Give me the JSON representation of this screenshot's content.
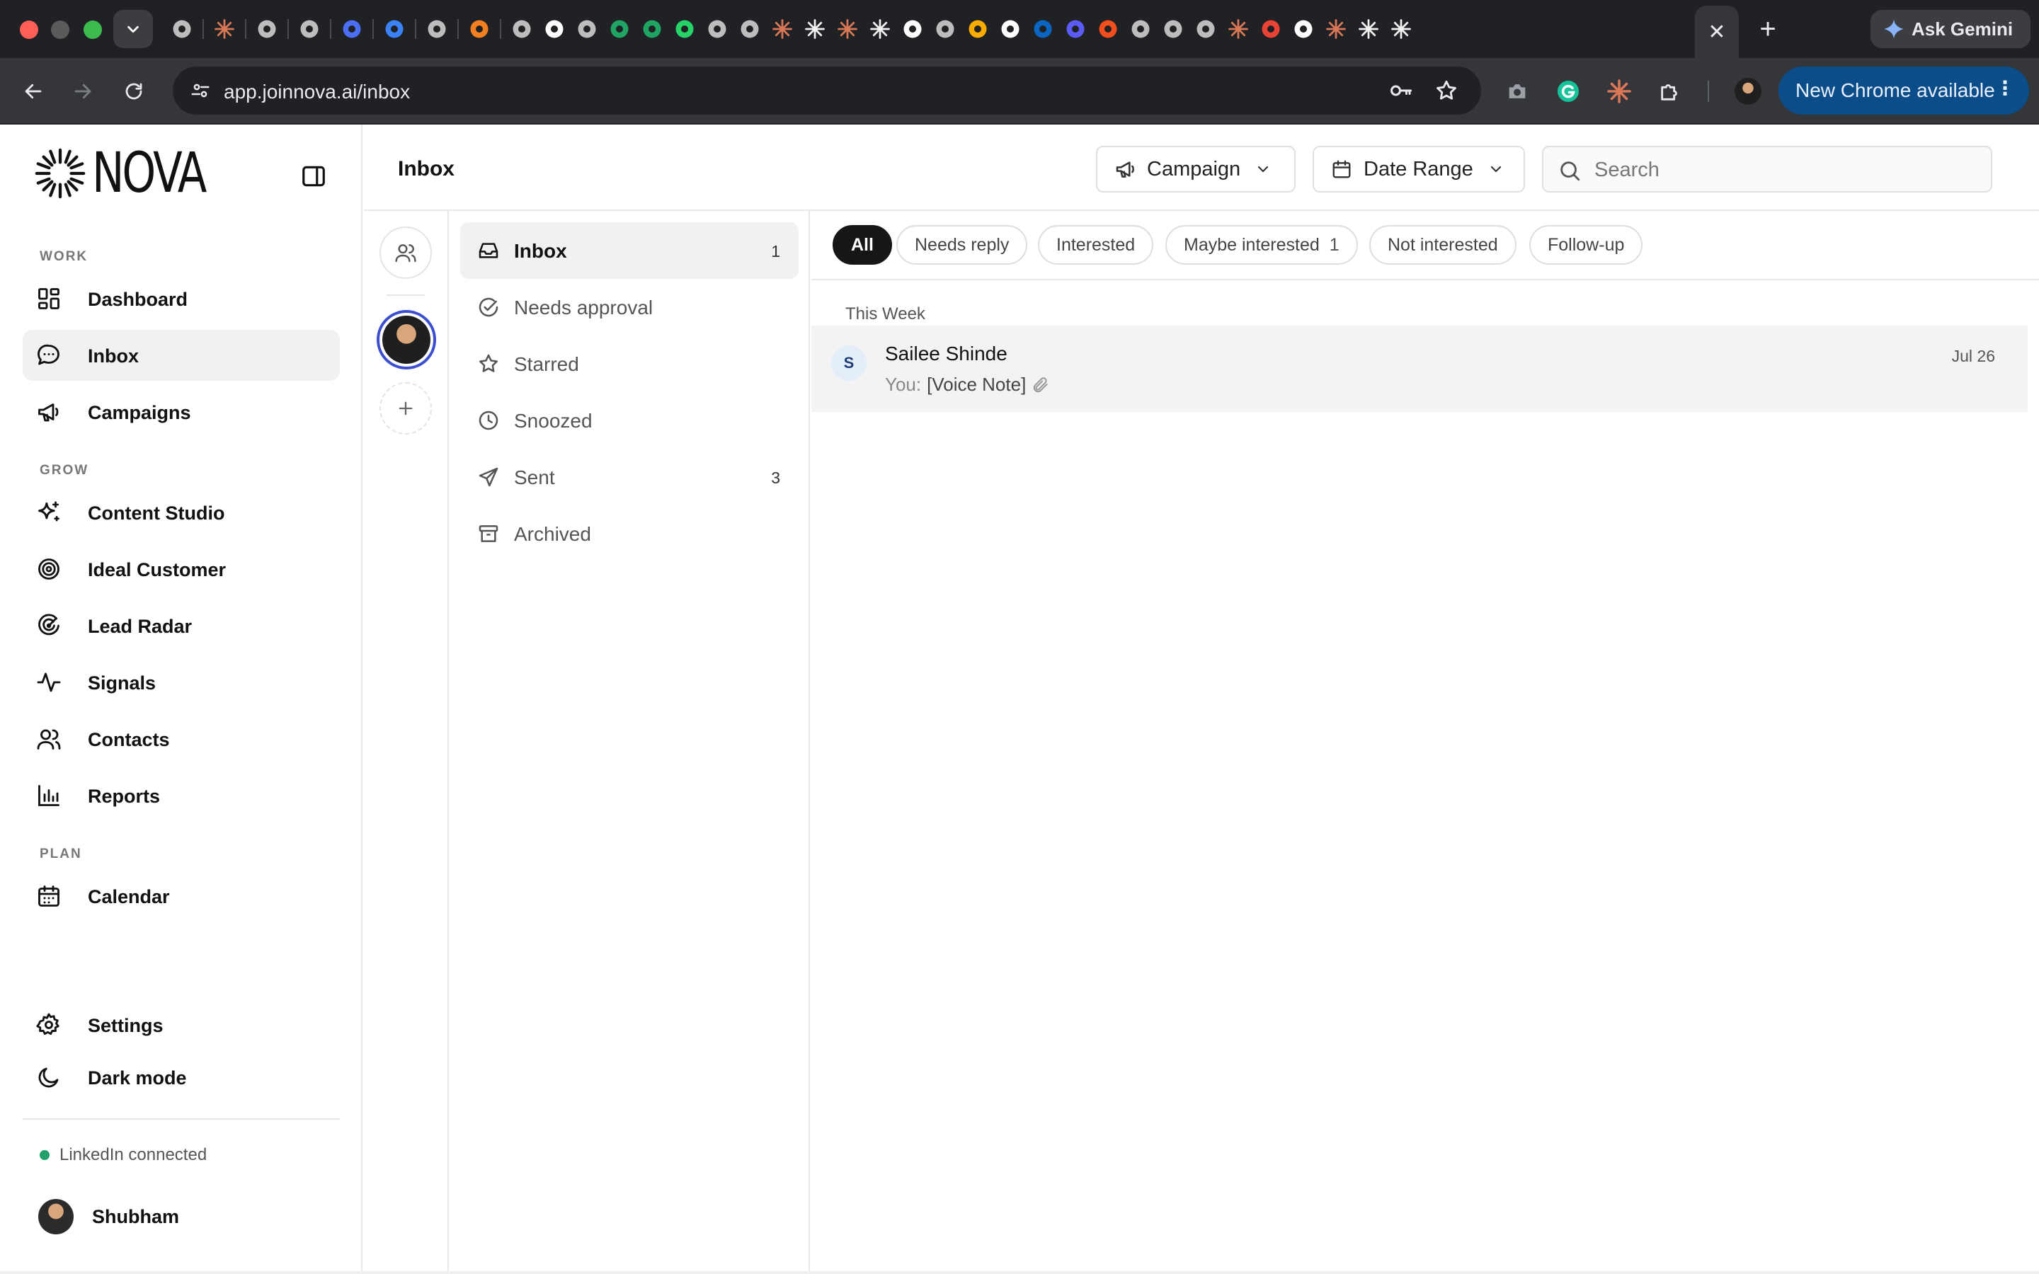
{
  "browser": {
    "url": "app.joinnova.ai/inbox",
    "gemini_label": "Ask Gemini",
    "update_label": "New Chrome available",
    "tab_icons": [
      "chatgpt-icon",
      "claude-icon",
      "perplexity-icon",
      "vercel-icon",
      "globe-icon",
      "send-icon",
      "grok-icon",
      "cloud-icon",
      "spotify-icon",
      "github-icon",
      "loader-icon",
      "drive-icon",
      "drive-icon",
      "whatsapp-icon",
      "play-icon",
      "medium-icon",
      "claude-icon",
      "nova-icon",
      "claude-icon",
      "nova-icon",
      "github-icon",
      "target-icon",
      "analytics-icon",
      "x-icon",
      "linkedin-icon",
      "chat-icon",
      "figma-icon",
      "openai-icon",
      "gemini-icon",
      "perplexity-icon",
      "claude-icon",
      "gmail-icon",
      "github-icon",
      "claude-icon",
      "nova-icon",
      "nova-icon"
    ],
    "close_tab_symbol": "✕",
    "new_tab_symbol": "+"
  },
  "sidebar": {
    "brand": "NOVA",
    "sections": {
      "work": "WORK",
      "grow": "GROW",
      "plan": "PLAN"
    },
    "items": {
      "dashboard": "Dashboard",
      "inbox": "Inbox",
      "campaigns": "Campaigns",
      "content_studio": "Content Studio",
      "ideal_customer": "Ideal Customer",
      "lead_radar": "Lead Radar",
      "signals": "Signals",
      "contacts": "Contacts",
      "reports": "Reports",
      "calendar": "Calendar",
      "settings": "Settings",
      "dark_mode": "Dark mode"
    },
    "linkedin_status": "LinkedIn connected",
    "user_name": "Shubham"
  },
  "header": {
    "title": "Inbox",
    "campaign_label": "Campaign",
    "date_range_label": "Date Range",
    "search_placeholder": "Search"
  },
  "folders": [
    {
      "label": "Inbox",
      "count": "1"
    },
    {
      "label": "Needs approval",
      "count": ""
    },
    {
      "label": "Starred",
      "count": ""
    },
    {
      "label": "Snoozed",
      "count": ""
    },
    {
      "label": "Sent",
      "count": "3"
    },
    {
      "label": "Archived",
      "count": ""
    }
  ],
  "filters": [
    {
      "label": "All",
      "count": ""
    },
    {
      "label": "Needs reply",
      "count": ""
    },
    {
      "label": "Interested",
      "count": ""
    },
    {
      "label": "Maybe interested",
      "count": "1"
    },
    {
      "label": "Not interested",
      "count": ""
    },
    {
      "label": "Follow-up",
      "count": ""
    }
  ],
  "threads": {
    "group_label": "This Week",
    "items": [
      {
        "initial": "S",
        "name": "Sailee Shinde",
        "prefix": "You:",
        "preview": "[Voice Note]",
        "attachment_icon": "paperclip-icon",
        "date": "Jul 26"
      }
    ]
  },
  "colors": {
    "accent_active_chip": "#161616",
    "status_connected": "#22a06b",
    "update_pill": "#0b4d88",
    "avatar_ring": "#3d4fd1"
  }
}
